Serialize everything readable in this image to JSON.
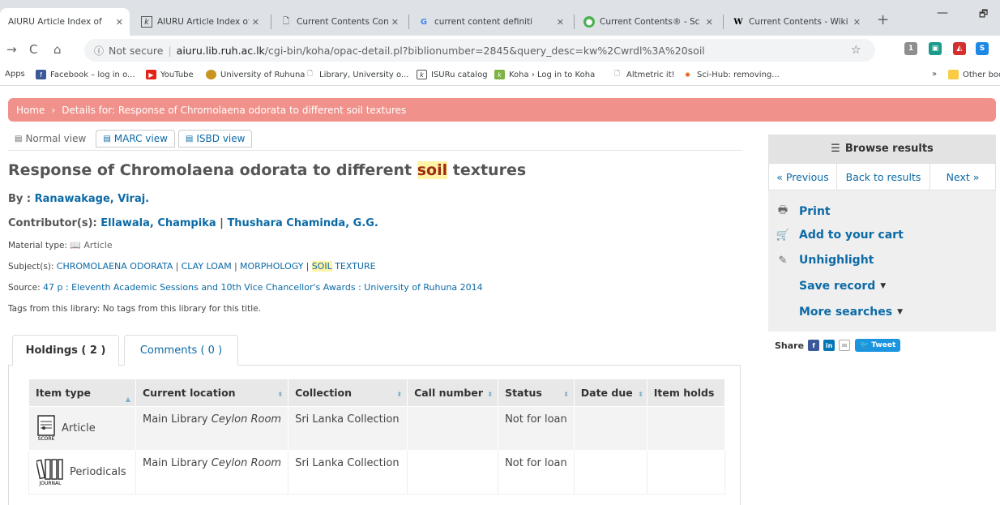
{
  "tabs": [
    {
      "title": "AIURU Article Index of",
      "icon": "koha-tab-icon",
      "active": true
    },
    {
      "title": "AIURU Article Index of",
      "icon": "koha-tab-icon"
    },
    {
      "title": "Current Contents Conn",
      "icon": "page-tab-icon"
    },
    {
      "title": "current content definiti",
      "icon": "google-tab-icon"
    },
    {
      "title": "Current Contents® - Sc",
      "icon": "globe-tab-icon"
    },
    {
      "title": "Current Contents - Wiki",
      "icon": "wikipedia-tab-icon"
    }
  ],
  "toolbar": {
    "security": "Not secure",
    "host": "aiuru.lib.ruh.ac.lk",
    "path": "/cgi-bin/koha/opac-detail.pl?biblionumber=2845&query_desc=kw%2Cwrdl%3A%20soil",
    "extension_badge": "1"
  },
  "bookmarks": [
    {
      "label": "Apps",
      "icon": "apps-icon"
    },
    {
      "label": "Facebook – log in o...",
      "icon": "facebook-icon"
    },
    {
      "label": "YouTube",
      "icon": "youtube-icon"
    },
    {
      "label": "University of Ruhuna",
      "icon": "university-icon"
    },
    {
      "label": "Library, University o...",
      "icon": "page-icon"
    },
    {
      "label": "ISURu catalog",
      "icon": "koha-icon"
    },
    {
      "label": "Koha › Log in to Koha",
      "icon": "koha-icon"
    },
    {
      "label": "Altmetric it!",
      "icon": "page-icon"
    },
    {
      "label": "Sci-Hub: removing...",
      "icon": "scihub-icon"
    },
    {
      "label": "»",
      "icon": "overflow-icon"
    },
    {
      "label": "Other boo",
      "icon": "folder-icon"
    }
  ],
  "breadcrumb": {
    "home": "Home",
    "separator": "›",
    "current": "Details for: Response of Chromolaena odorata to different soil textures"
  },
  "views": {
    "normal": "Normal view",
    "marc": "MARC view",
    "isbd": "ISBD view"
  },
  "record": {
    "title_before": "Response of Chromolaena odorata to different",
    "title_highlight": "soil",
    "title_after": "textures",
    "by_label": "By :",
    "author": "Ranawakage, Viraj.",
    "contributors_label": "Contributor(s):",
    "contributor_1": "Ellawala, Champika",
    "contributor_sep": "|",
    "contributor_2": "Thushara Chaminda, G.G.",
    "material_label": "Material type:",
    "material_value": "Article",
    "subjects_label": "Subject(s):",
    "subjects": [
      "CHROMOLAENA ODORATA",
      "CLAY LOAM",
      "MORPHOLOGY"
    ],
    "subject_last_highlight": "SOIL",
    "subject_last_rest": "TEXTURE",
    "subject_sep": "|",
    "source_label": "Source:",
    "source_value": "47 p : Eleventh Academic Sessions and 10th Vice Chancellor's Awards : University of Ruhuna 2014",
    "tags_label": "Tags from this library:",
    "tags_value": "No tags from this library for this title."
  },
  "holdings_tabs": {
    "holdings": "Holdings ( 2 )",
    "comments": "Comments ( 0 )"
  },
  "holdings_table": {
    "columns": [
      "Item type",
      "Current location",
      "Collection",
      "Call number",
      "Status",
      "Date due",
      "Item holds"
    ],
    "rows": [
      {
        "item_type": "Article",
        "icon_label": "SCORE",
        "location": "Main Library",
        "location_room": "Ceylon Room",
        "collection": "Sri Lanka Collection",
        "call_number": "",
        "status": "Not for loan",
        "date_due": "",
        "holds": ""
      },
      {
        "item_type": "Periodicals",
        "icon_label": "JOURNAL",
        "location": "Main Library",
        "location_room": "Ceylon Room",
        "collection": "Sri Lanka Collection",
        "call_number": "",
        "status": "Not for loan",
        "date_due": "",
        "holds": ""
      }
    ]
  },
  "sidebar": {
    "browse": "Browse results",
    "previous": "« Previous",
    "back": "Back to results",
    "next": "Next »",
    "print": "Print",
    "cart": "Add to your cart",
    "unhighlight": "Unhighlight",
    "save": "Save record",
    "more": "More searches"
  },
  "share": {
    "label": "Share",
    "tweet": "Tweet"
  },
  "colors": {
    "breadcrumb_bg": "#f0928b",
    "link": "#0c6aa6",
    "status_red": "#a0261a",
    "highlight": "#fff3a6"
  }
}
